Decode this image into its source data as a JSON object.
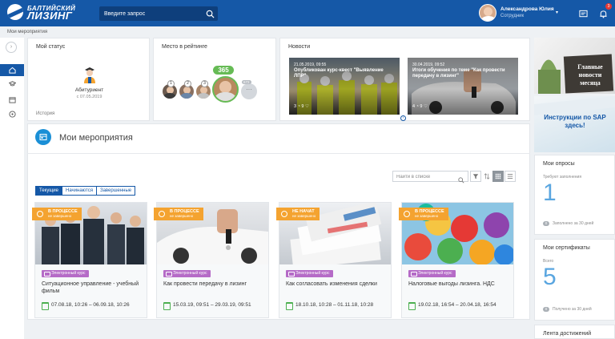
{
  "header": {
    "logo_line1": "БАЛТИЙСКИЙ",
    "logo_line2": "ЛИЗИНГ",
    "search_placeholder": "Введите запрос",
    "user_name": "Александрова Юлия",
    "user_role": "Сотрудник",
    "notifications_count": "3"
  },
  "breadcrumb": "Мои мероприятия",
  "status_card": {
    "title": "Мой статус",
    "status": "Абитуриент",
    "date": "с 07.05.2019",
    "history_link": "История"
  },
  "rating_card": {
    "title": "Место в рейтинге",
    "ranks": [
      "1",
      "2",
      "3"
    ],
    "score": "365",
    "more_count": "672",
    "more_label": "···"
  },
  "news_card": {
    "title": "Новости",
    "items": [
      {
        "date": "21.05.2019, 09:55",
        "title": "Опубликован курс-квест \"Выявление ЛПР\"",
        "stats": "3 ◔ 9 ♡"
      },
      {
        "date": "30.04.2019, 09:52",
        "title": "Итоги обучения по теме \"Как провести передачу в лизинг\"",
        "stats": "4 ◔ 9 ♡"
      }
    ]
  },
  "ads": [
    {
      "text": "Главные новости месяца"
    },
    {
      "text": "Инструкции по SAP здесь!"
    }
  ],
  "events": {
    "title": "Мои мероприятия",
    "search_placeholder": "Найти в списке",
    "tabs": [
      "Текущие",
      "Начинаются",
      "Завершенные"
    ],
    "active_tab": 0,
    "cards": [
      {
        "status": "В ПРОЦЕССЕ",
        "substatus": "не завершено",
        "type": "Электронный курс",
        "name": "Ситуационное управление - учебный фильм",
        "dates": "07.08.18, 10:26 – 06.09.18, 10:26"
      },
      {
        "status": "В ПРОЦЕССЕ",
        "substatus": "не завершено",
        "type": "Электронный курс",
        "name": "Как провести передачу в лизинг",
        "dates": "15.03.19, 09:51 – 29.03.19, 09:51"
      },
      {
        "status": "НЕ НАЧАТ",
        "substatus": "не завершено",
        "type": "Электронный курс",
        "name": "Как согласовать изменения сделки",
        "dates": "18.10.18, 10:28 – 01.11.18, 10:28"
      },
      {
        "status": "В ПРОЦЕССЕ",
        "substatus": "не завершено",
        "type": "Электронный курс",
        "name": "Налоговые выгоды лизинга. НДС",
        "dates": "19.02.18, 16:54 – 20.04.18, 16:54"
      }
    ]
  },
  "surveys": {
    "title": "Мои опросы",
    "subtitle": "Требуют заполнения",
    "count": "1",
    "footer_count": "0",
    "footer": "Заполнено за 30 дней"
  },
  "certificates": {
    "title": "Мои сертификаты",
    "subtitle": "Всего",
    "count": "5",
    "footer_count": "0",
    "footer": "Получено за 30 дней"
  },
  "achievements": {
    "title": "Лента достижений"
  }
}
